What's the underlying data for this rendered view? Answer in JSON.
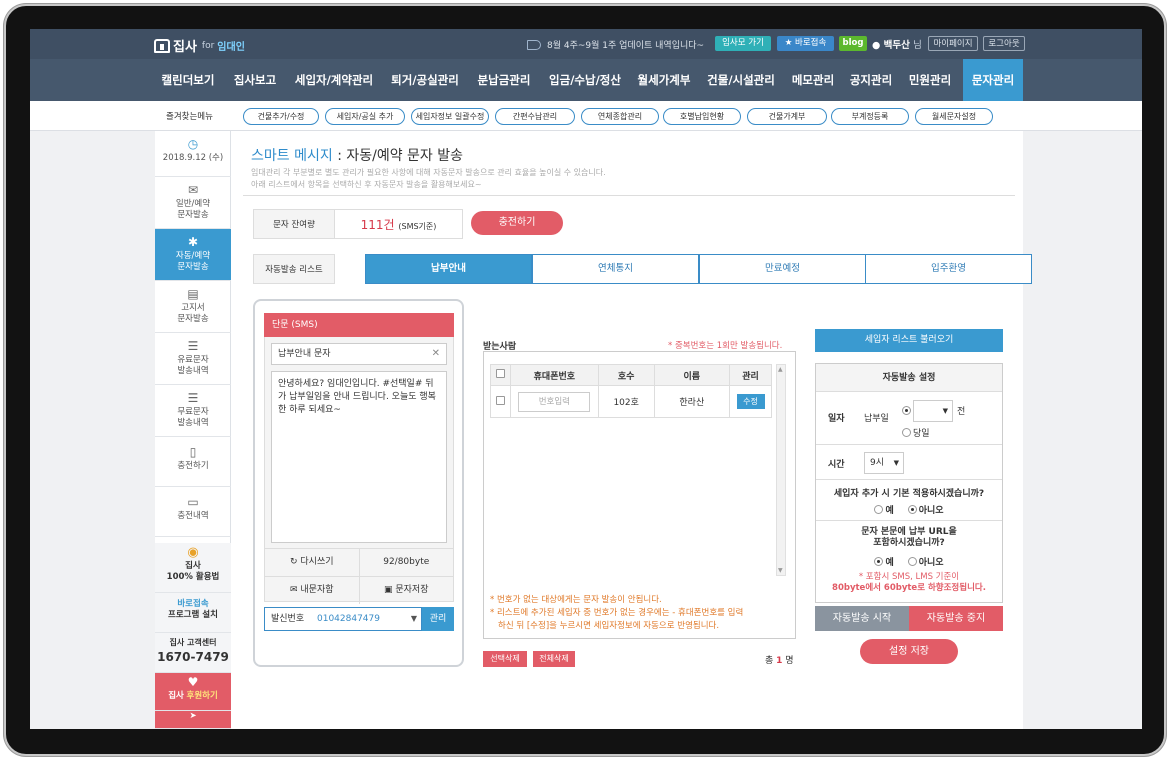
{
  "topbar": {
    "logo_text": "집사",
    "logo_for": "for",
    "logo_sub": "임대인",
    "notice": "8월 4주~9월 1주 업데이트 내역입니다~",
    "btn_go": "임사모 가기",
    "btn_fast": "바로접속",
    "btn_blog": "blog",
    "user_name": "백두산",
    "user_suffix": "님",
    "btn_mypage": "마이페이지",
    "btn_logout": "로그아웃"
  },
  "nav": {
    "items": [
      "캘린더보기",
      "집사보고",
      "세입자/계약관리",
      "퇴거/공실관리",
      "분납금관리",
      "입금/수납/정산",
      "월세가계부",
      "건물/시설관리",
      "메모관리",
      "공지관리",
      "민원관리",
      "문자관리"
    ]
  },
  "quick": {
    "title": "즐겨찾는메뉴",
    "items": [
      "건물추가/수정",
      "세입자/공실 추가",
      "세입자정보 일괄수정",
      "간편수납관리",
      "연체종합관리",
      "호별납입현황",
      "건물가계부",
      "부계정등록",
      "월세문자설정"
    ]
  },
  "sidebar": {
    "date": "2018.9.12 (수)",
    "items": [
      {
        "line1": "일반/예약",
        "line2": "문자발송"
      },
      {
        "line1": "자동/예약",
        "line2": "문자발송"
      },
      {
        "line1": "고지서",
        "line2": "문자발송"
      },
      {
        "line1": "유료문자",
        "line2": "발송내역"
      },
      {
        "line1": "무료문자",
        "line2": "발송내역"
      },
      {
        "line1": "충전하기",
        "line2": ""
      },
      {
        "line1": "충전내역",
        "line2": ""
      }
    ],
    "promo1_title": "집사",
    "promo1_sub": "100% 활용법",
    "promo2_title": "바로접속",
    "promo2_sub": "프로그램 설치",
    "cs_label": "집사 고객센터",
    "cs_phone": "1670-7479",
    "sponsor_prefix": "집사",
    "sponsor": "후원하기"
  },
  "page": {
    "title_blue": "스마트 메시지",
    "title_dark": ": 자동/예약 문자 발송",
    "desc1": "임대관리 각 부분별로 별도 관리가 필요한 사항에 대해 자동문자 발송으로 관리 효율을 높이실 수 있습니다.",
    "desc2": "아래 리스트에서 항목을 선택하신 후 자동문자 발송을 활용해보세요~"
  },
  "balance": {
    "label": "문자 잔여량",
    "value": "111건",
    "unit": "(SMS기준)",
    "charge": "충전하기"
  },
  "tabs": {
    "label": "자동발송 리스트",
    "items": [
      "납부안내",
      "연체통지",
      "만료예정",
      "입주환영"
    ]
  },
  "phone": {
    "head": "단문 (SMS)",
    "subject": "납부안내 문자",
    "body": "안녕하세요? 임대인입니다. #선택일# 뒤가 납부일임을 안내 드립니다. 오늘도 행복한 하루 되세요~",
    "rewrite": "다시쓰기",
    "bytes": "92/80byte",
    "my_msgs": "내문자함",
    "save_msg": "문자저장",
    "sender_label": "발신번호",
    "sender_number": "01042847479",
    "manage": "관리"
  },
  "recipients": {
    "title": "받는사람",
    "note": "* 중복번호는 1회만 발송됩니다.",
    "headers": [
      "휴대폰번호",
      "호수",
      "이름",
      "관리"
    ],
    "row": {
      "phone_placeholder": "번호입력",
      "unit": "102호",
      "name": "한라산",
      "action": "수정"
    },
    "note1": "* 번호가 없는 대상에게는 문자 발송이 안됩니다.",
    "note2": "* 리스트에 추가된 세입자 중 번호가 없는 경우에는 - 휴대폰번호를 입력",
    "note3": "하신 뒤 [수정]을 누르시면 세입자정보에 자동으로 반영됩니다.",
    "btn_delete_selected": "선택삭제",
    "btn_delete_all": "전체삭제",
    "total_prefix": "총",
    "total_count": "1",
    "total_suffix": "명"
  },
  "settings": {
    "load": "세입자 리스트 불러오기",
    "head": "자동발송 설정",
    "date_label": "일자",
    "due_label": "납부일",
    "before": "전",
    "same_day": "당일",
    "time_label": "시간",
    "time_value": "9시",
    "q1": "세입자 추가 시 기본 적용하시겠습니까?",
    "yes": "예",
    "no": "아니오",
    "q2a": "문자 본문에 납부 URL을",
    "q2b": "포함하시겠습니까?",
    "warn1": "* 포함시 SMS, LMS 기준이",
    "warn2": "80byte에서 60byte로 하향조정됩니다.",
    "start": "자동발송 시작",
    "stop": "자동발송 중지",
    "save": "설정 저장"
  },
  "colors": {
    "nav_bg": "#46586d",
    "accent_blue": "#3a9ad0",
    "accent_red": "#e25c67"
  }
}
